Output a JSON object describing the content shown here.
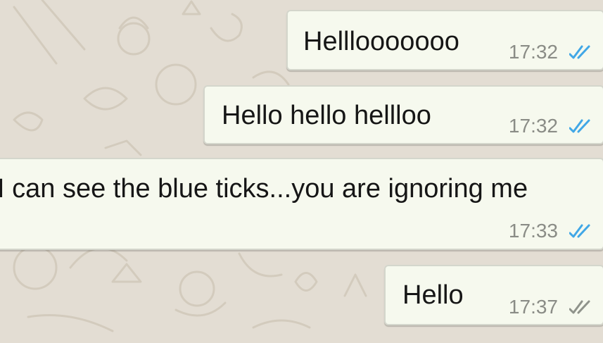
{
  "messages": [
    {
      "text": "Helllooooooo",
      "time": "17:32",
      "status": "read",
      "tick_color": "#41a7e6"
    },
    {
      "text": "Hello hello hellloo",
      "time": "17:32",
      "status": "read",
      "tick_color": "#41a7e6"
    },
    {
      "text": "I can see the blue ticks...you are ignoring me",
      "time": "17:33",
      "status": "read",
      "tick_color": "#41a7e6"
    },
    {
      "text": "Hello",
      "time": "17:37",
      "status": "delivered",
      "tick_color": "#8f938b"
    }
  ],
  "colors": {
    "wallpaper": "#e3ddd3",
    "bubble": "#f6f9ee",
    "read_ticks": "#41a7e6",
    "delivered_ticks": "#8f938b",
    "time_text": "#8a8c86"
  },
  "icons": [
    "double-check-icon"
  ]
}
